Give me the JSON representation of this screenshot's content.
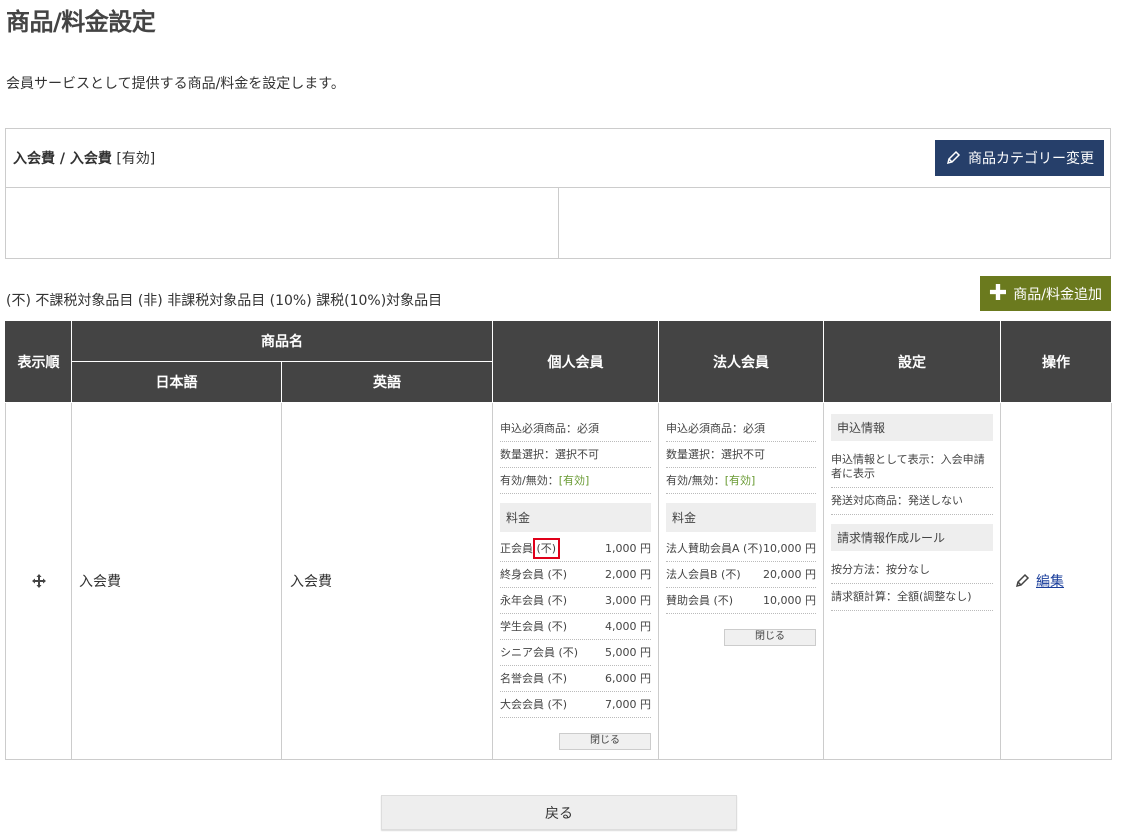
{
  "page": {
    "title": "商品/料金設定",
    "description": "会員サービスとして提供する商品/料金を設定します。"
  },
  "category": {
    "name": "入会費 / 入会費",
    "status": "[有効]",
    "change_button": "商品カテゴリー変更"
  },
  "legend": "(不) 不課税対象品目 (非) 非課税対象品目 (10%) 課税(10%)対象品目",
  "add_button": "商品/料金追加",
  "table": {
    "headers": {
      "order": "表示順",
      "product_name": "商品名",
      "japanese": "日本語",
      "english": "英語",
      "individual": "個人会員",
      "corporate": "法人会員",
      "settings": "設定",
      "actions": "操作"
    },
    "row": {
      "name_ja": "入会費",
      "name_en": "入会費",
      "individual": {
        "required": "申込必須商品：必須",
        "quantity": "数量選択：選択不可",
        "valid_label": "有効/無効：",
        "valid_value": "[有効]",
        "price_section": "料金",
        "prices": [
          {
            "name": "正会員",
            "tax": "(不)",
            "amount": "1,000 円"
          },
          {
            "name": "終身会員",
            "tax": "(不)",
            "amount": "2,000 円"
          },
          {
            "name": "永年会員",
            "tax": "(不)",
            "amount": "3,000 円"
          },
          {
            "name": "学生会員",
            "tax": "(不)",
            "amount": "4,000 円"
          },
          {
            "name": "シニア会員",
            "tax": "(不)",
            "amount": "5,000 円"
          },
          {
            "name": "名誉会員",
            "tax": "(不)",
            "amount": "6,000 円"
          },
          {
            "name": "大会会員",
            "tax": "(不)",
            "amount": "7,000 円"
          }
        ],
        "close_button": "閉じる"
      },
      "corporate": {
        "required": "申込必須商品：必須",
        "quantity": "数量選択：選択不可",
        "valid_label": "有効/無効：",
        "valid_value": "[有効]",
        "price_section": "料金",
        "prices": [
          {
            "name": "法人賛助会員A",
            "tax": "(不)",
            "amount": "10,000 円"
          },
          {
            "name": "法人会員B",
            "tax": "(不)",
            "amount": "20,000 円"
          },
          {
            "name": "賛助会員",
            "tax": "(不)",
            "amount": "10,000 円"
          }
        ],
        "close_button": "閉じる"
      },
      "settings": {
        "application_section": "申込情報",
        "application_display": "申込情報として表示：入会申請者に表示",
        "shipping": "発送対応商品：発送しない",
        "billing_section": "請求情報作成ルール",
        "allocation": "按分方法：按分なし",
        "billing_calc": "請求額計算：全額(調整なし)"
      },
      "edit_link": "編集"
    }
  },
  "back_button": "戻る",
  "colors": {
    "header_bg": "#444444",
    "navy_button": "#263f6a",
    "olive_button": "#6b7a1e",
    "valid_green": "#6a9b34",
    "highlight_red": "#e0001a",
    "link_blue": "#1a3e9b"
  }
}
